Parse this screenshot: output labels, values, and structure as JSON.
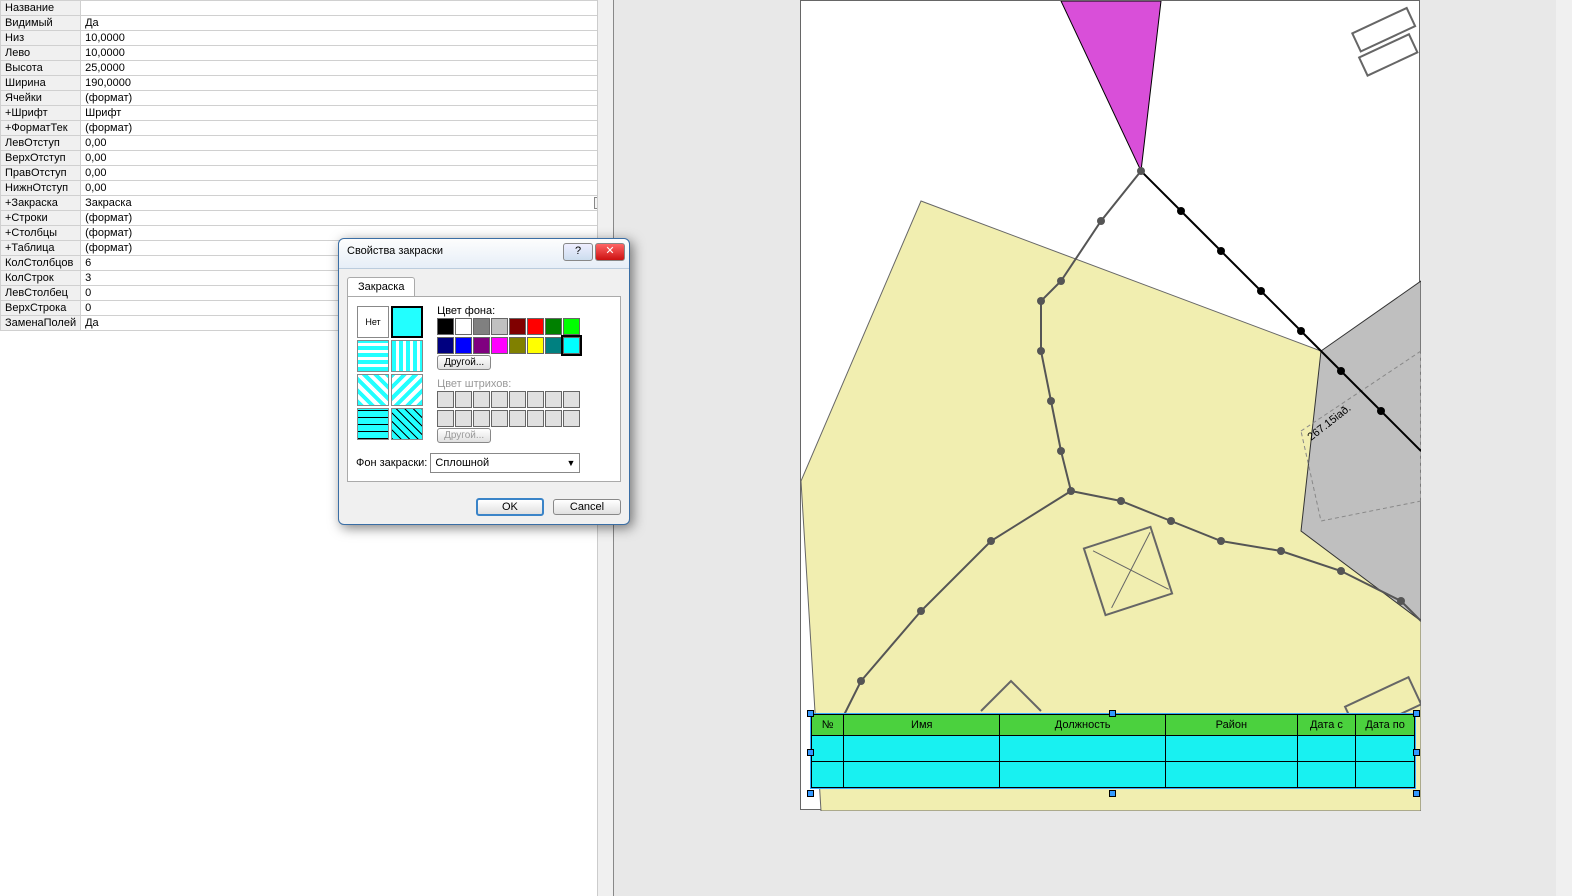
{
  "props": [
    {
      "k": "Название",
      "v": ""
    },
    {
      "k": "Видимый",
      "v": "Да"
    },
    {
      "k": "Низ",
      "v": "10,0000"
    },
    {
      "k": "Лево",
      "v": "10,0000"
    },
    {
      "k": "Высота",
      "v": "25,0000"
    },
    {
      "k": "Ширина",
      "v": "190,0000"
    },
    {
      "k": "Ячейки",
      "v": "(формат)"
    },
    {
      "k": "  +Шрифт",
      "v": "Шрифт"
    },
    {
      "k": " +ФорматТек",
      "v": "(формат)"
    },
    {
      "k": "  ЛевОтступ",
      "v": "0,00"
    },
    {
      "k": "  ВерхОтступ",
      "v": "0,00"
    },
    {
      "k": "  ПравОтступ",
      "v": "0,00"
    },
    {
      "k": "  НижнОтступ",
      "v": "0,00"
    },
    {
      "k": "  +Закраска",
      "v": "Закраска",
      "sel": true
    },
    {
      "k": "+Строки",
      "v": "(формат)"
    },
    {
      "k": "+Столбцы",
      "v": "(формат)"
    },
    {
      "k": "+Таблица",
      "v": "(формат)"
    },
    {
      "k": "КолСтолбцов",
      "v": "6"
    },
    {
      "k": "КолСтрок",
      "v": "3"
    },
    {
      "k": "ЛевСтолбец",
      "v": "0"
    },
    {
      "k": "ВерхСтрока",
      "v": "0"
    },
    {
      "k": "ЗаменаПолей",
      "v": "Да"
    }
  ],
  "dialog": {
    "title": "Свойства закраски",
    "tab": "Закраска",
    "none": "Нет",
    "bg_label": "Цвет фона:",
    "hatch_label": "Цвет штрихов:",
    "other": "Другой...",
    "fill_label": "Фон закраски:",
    "fill_value": "Сплошной",
    "ok": "OK",
    "cancel": "Cancel"
  },
  "table": {
    "headers": [
      "№",
      "Имя",
      "Должность",
      "Район",
      "Дата с",
      "Дата по"
    ]
  },
  "map": {
    "dim_label": "267.15іаð."
  },
  "colors_bg": [
    "#000000",
    "#ffffff",
    "#808080",
    "#c0c0c0",
    "#800000",
    "#ff0000",
    "#008000",
    "#00ff00",
    "#000080",
    "#0000ff",
    "#800080",
    "#ff00ff",
    "#808000",
    "#ffff00",
    "#008080",
    "#00ffff"
  ],
  "colors_hatch": [
    "#e0e0e0",
    "#e0e0e0",
    "#e0e0e0",
    "#e0e0e0",
    "#e0e0e0",
    "#e0e0e0",
    "#e0e0e0",
    "#e0e0e0",
    "#e0e0e0",
    "#e0e0e0",
    "#e0e0e0",
    "#e0e0e0",
    "#e0e0e0",
    "#e0e0e0",
    "#e0e0e0",
    "#e0e0e0"
  ]
}
